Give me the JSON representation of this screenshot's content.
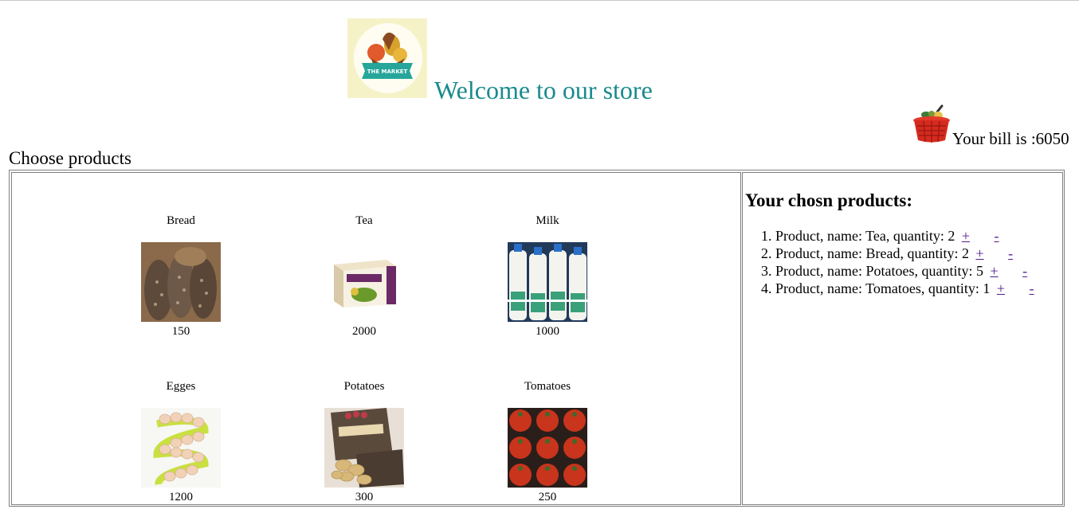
{
  "header": {
    "logo_text": "THE MARKET",
    "welcome": "Welcome to our store",
    "cart_icon": "shopping-basket-icon",
    "bill_label": "Your bill is :6050"
  },
  "catalog": {
    "heading": "Choose products",
    "products": [
      {
        "name": "Bread",
        "price": "150",
        "image": "bread-photo"
      },
      {
        "name": "Tea",
        "price": "2000",
        "image": "tea-box-photo"
      },
      {
        "name": "Milk",
        "price": "1000",
        "image": "milk-bottles-photo"
      },
      {
        "name": "Egges",
        "price": "1200",
        "image": "egg-spiral-photo"
      },
      {
        "name": "Potatoes",
        "price": "300",
        "image": "potato-bag-photo"
      },
      {
        "name": "Tomatoes",
        "price": "250",
        "image": "tomatoes-photo"
      }
    ]
  },
  "chosen": {
    "title": "Your chosn products:",
    "items": [
      {
        "text": "1. Product, name: Tea, quantity: 2",
        "plus": "+",
        "minus": "-"
      },
      {
        "text": "2. Product, name: Bread, quantity: 2",
        "plus": "+",
        "minus": "-"
      },
      {
        "text": "3. Product, name: Potatoes, quantity: 5",
        "plus": "+",
        "minus": "-"
      },
      {
        "text": "4. Product, name: Tomatoes, quantity: 1",
        "plus": "+",
        "minus": "-"
      }
    ]
  },
  "colors": {
    "welcome": "#1a8a8c",
    "link": "#551a8b",
    "border": "#808080"
  }
}
